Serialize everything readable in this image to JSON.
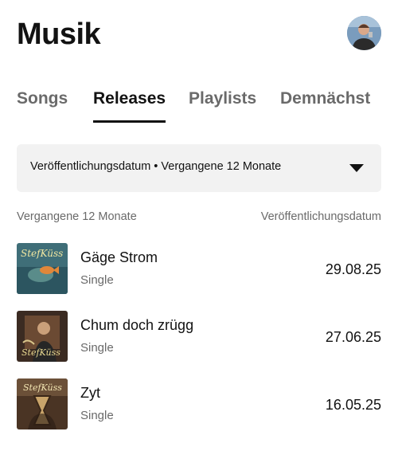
{
  "header": {
    "title": "Musik"
  },
  "tabs": [
    {
      "label": "Songs",
      "active": false
    },
    {
      "label": "Releases",
      "active": true
    },
    {
      "label": "Playlists",
      "active": false
    },
    {
      "label": "Demnächst",
      "active": false
    }
  ],
  "filter": {
    "label": "Veröffentlichungsdatum • Vergangene 12 Monate"
  },
  "list_header": {
    "left": "Vergangene 12 Monate",
    "right": "Veröffentlichungsdatum"
  },
  "releases": [
    {
      "title": "Gäge Strom",
      "type": "Single",
      "date": "29.08.25",
      "cover_text": "StefKüss"
    },
    {
      "title": "Chum doch zrügg",
      "type": "Single",
      "date": "27.06.25",
      "cover_text": "StefKüss"
    },
    {
      "title": "Zyt",
      "type": "Single",
      "date": "16.05.25",
      "cover_text": "StefKüss"
    }
  ],
  "icons": {
    "dropdown": "triangle-down-icon",
    "avatar": "profile-avatar"
  }
}
